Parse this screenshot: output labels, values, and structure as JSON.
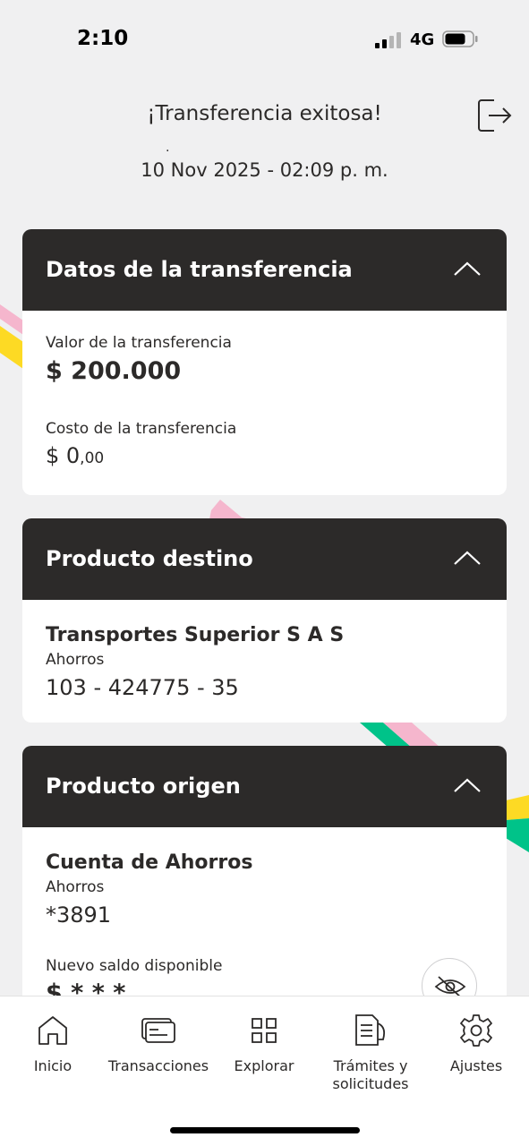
{
  "status_bar": {
    "time": "2:10",
    "network": "4G"
  },
  "header": {
    "title": "¡Transferencia exitosa!",
    "dot": ".",
    "date": "10 Nov 2025 - 02:09 p. m."
  },
  "transfer_card": {
    "title": "Datos de la transferencia",
    "value_label": "Valor de la transferencia",
    "value": "$ 200.000",
    "cost_label": "Costo de la transferencia",
    "cost_whole": "$ 0",
    "cost_cents": ",00"
  },
  "destination_card": {
    "title": "Producto destino",
    "holder": "Transportes Superior S A S",
    "account_type": "Ahorros",
    "account_number": "103 - 424775 - 35"
  },
  "origin_card": {
    "title": "Producto origen",
    "product_name": "Cuenta de Ahorros",
    "account_type": "Ahorros",
    "account_number": "*3891",
    "balance_label": "Nuevo saldo disponible",
    "balance_masked": "$ * * *"
  },
  "bottom_nav": {
    "items": [
      {
        "label": "Inicio",
        "icon": "home-icon"
      },
      {
        "label": "Transacciones",
        "icon": "card-icon"
      },
      {
        "label": "Explorar",
        "icon": "grid-icon"
      },
      {
        "label": "Trámites y solicitudes",
        "icon": "documents-icon"
      },
      {
        "label": "Ajustes",
        "icon": "gear-icon"
      }
    ]
  },
  "colors": {
    "card_header": "#2c2a29",
    "background": "#f0f0f1",
    "accent_yellow": "#fdda24",
    "accent_pink": "#f5b6cd",
    "accent_green": "#00c389"
  }
}
